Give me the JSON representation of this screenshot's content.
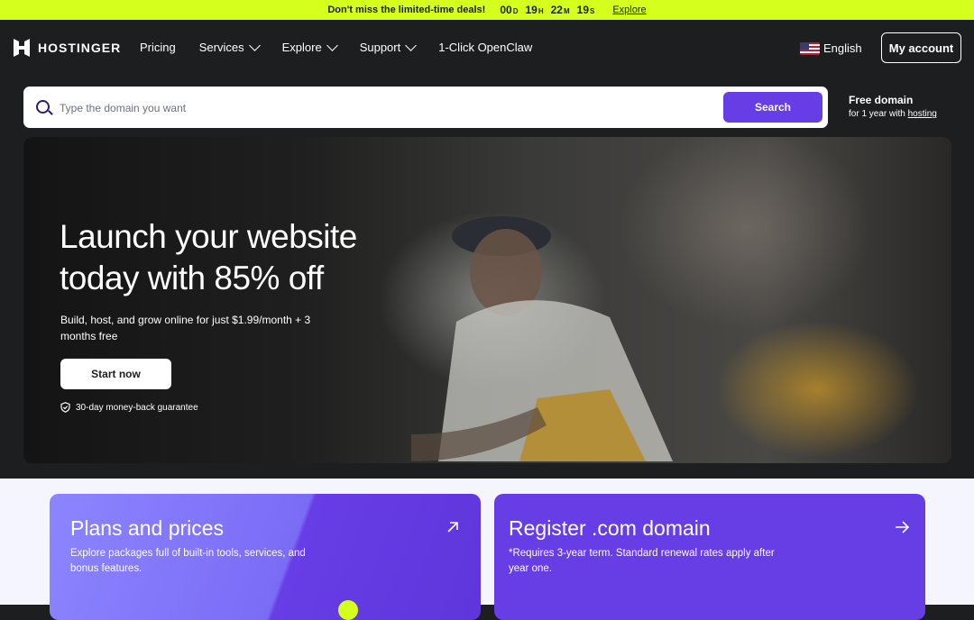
{
  "promo": {
    "text": "Don't miss the limited-time deals!",
    "countdown": [
      {
        "value": "00",
        "unit": "D"
      },
      {
        "value": "19",
        "unit": "H"
      },
      {
        "value": "22",
        "unit": "M"
      },
      {
        "value": "19",
        "unit": "S"
      }
    ],
    "link": "Explore"
  },
  "header": {
    "logo_text": "HOSTINGER",
    "nav": [
      {
        "label": "Pricing",
        "dropdown": false
      },
      {
        "label": "Services",
        "dropdown": true
      },
      {
        "label": "Explore",
        "dropdown": true
      },
      {
        "label": "Support",
        "dropdown": true
      },
      {
        "label": "1-Click OpenClaw",
        "dropdown": false
      }
    ],
    "language": "English",
    "account": "My account"
  },
  "search": {
    "placeholder": "Type the domain you want",
    "button": "Search",
    "free_title": "Free domain",
    "free_sub_prefix": "for 1 year with ",
    "free_sub_link": "hosting"
  },
  "hero": {
    "title": "Launch your website today with 85% off",
    "subtitle": "Build, host, and grow online for just $1.99/month + 3 months free",
    "cta": "Start now",
    "guarantee": "30-day money-back guarantee"
  },
  "cards": [
    {
      "title": "Plans and prices",
      "desc": "Explore packages full of built-in tools, services, and bonus features."
    },
    {
      "title": "Register .com domain",
      "desc": "*Requires 3-year term. Standard renewal rates apply after year one."
    }
  ],
  "colors": {
    "promo_bg": "#d5ff1d",
    "header_bg": "#1d1e20",
    "accent": "#673de6",
    "card_bg": "#f4f5ff"
  }
}
